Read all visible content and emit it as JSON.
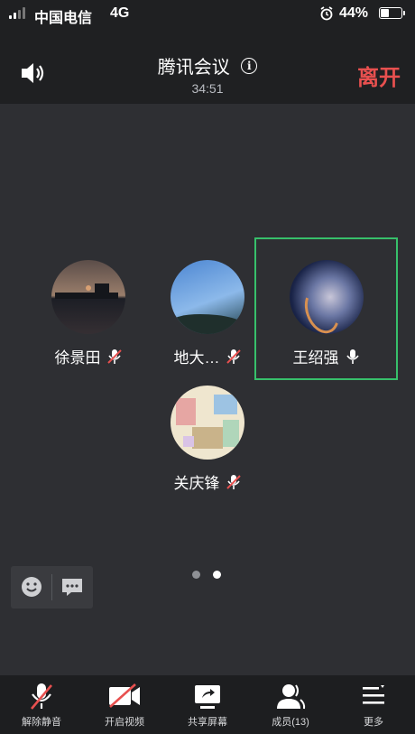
{
  "status_bar": {
    "carrier": "中国电信",
    "network": "4G",
    "battery_percent": "44%",
    "battery_level": 0.44
  },
  "header": {
    "title": "腾讯会议",
    "timer": "34:51",
    "leave_label": "离开"
  },
  "participants": [
    {
      "name": "徐景田",
      "mic": "muted",
      "active": false
    },
    {
      "name": "地大…",
      "mic": "muted",
      "active": false
    },
    {
      "name": "王绍强",
      "mic": "on",
      "active": true
    },
    {
      "name": "关庆锋",
      "mic": "muted",
      "active": false
    }
  ],
  "pager": {
    "pages": 2,
    "current": 2
  },
  "float_controls": [
    {
      "icon": "emoji-icon"
    },
    {
      "icon": "chat-icon"
    }
  ],
  "toolbar": [
    {
      "label": "解除静音",
      "icon": "mic-muted-icon"
    },
    {
      "label": "开启视频",
      "icon": "camera-off-icon"
    },
    {
      "label": "共享屏幕",
      "icon": "share-screen-icon"
    },
    {
      "label": "成员(13)",
      "icon": "members-icon"
    },
    {
      "label": "更多",
      "icon": "more-menu-icon"
    }
  ],
  "colors": {
    "background": "#2e2f33",
    "bar": "#1f2022",
    "leave": "#e8504f",
    "active_speaker": "#37c06b",
    "muted_slash": "#e8504f"
  }
}
